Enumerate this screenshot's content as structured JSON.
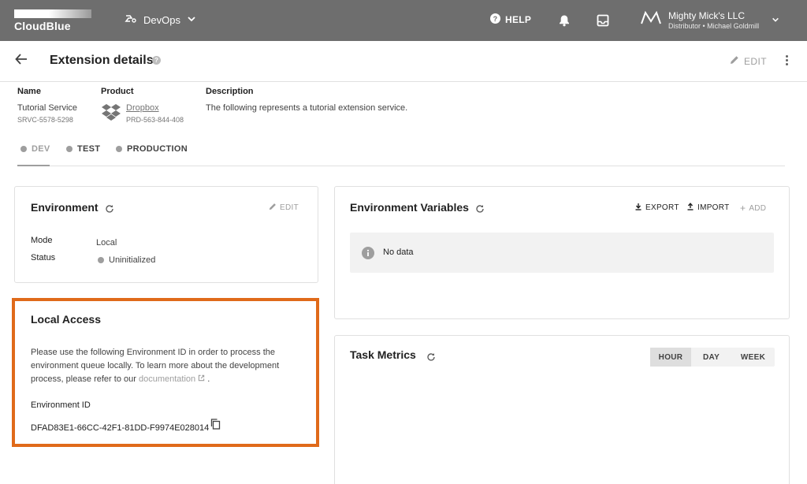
{
  "topbar": {
    "logo_text": "CloudBlue",
    "app_name": "DevOps",
    "help_label": "HELP",
    "account_name": "Mighty Mick's LLC",
    "account_sub": "Distributor • Michael Goldmill"
  },
  "header": {
    "title": "Extension details",
    "edit_label": "EDIT"
  },
  "info": {
    "name_label": "Name",
    "name_value": "Tutorial Service",
    "name_id": "SRVC-5578-5298",
    "product_label": "Product",
    "product_value": "Dropbox",
    "product_id": "PRD-563-844-408",
    "description_label": "Description",
    "description_value": "The following represents a tutorial extension service."
  },
  "env_tabs": [
    {
      "label": "DEV",
      "active": true
    },
    {
      "label": "TEST",
      "active": false
    },
    {
      "label": "PRODUCTION",
      "active": false
    }
  ],
  "environment_card": {
    "title": "Environment",
    "edit_label": "EDIT",
    "mode_label": "Mode",
    "mode_value": "Local",
    "status_label": "Status",
    "status_value": "Uninitialized"
  },
  "env_vars_card": {
    "title": "Environment Variables",
    "export_label": "EXPORT",
    "import_label": "IMPORT",
    "add_label": "ADD",
    "empty_text": "No data"
  },
  "local_access": {
    "title": "Local Access",
    "text_before": "Please use the following Environment ID in order to process the environment queue locally. To learn more about the development process, please refer to our ",
    "link_text": "documentation",
    "text_after": ".",
    "env_id_label": "Environment ID",
    "env_id_value": "DFAD83E1-66CC-42F1-81DD-F9974E028014"
  },
  "task_metrics": {
    "title": "Task Metrics",
    "periods": [
      {
        "label": "HOUR",
        "active": true
      },
      {
        "label": "DAY",
        "active": false
      },
      {
        "label": "WEEK",
        "active": false
      }
    ]
  },
  "colors": {
    "topbar": "#6e6e6e",
    "highlight_border": "#e06a1a",
    "muted": "#9e9e9e"
  }
}
